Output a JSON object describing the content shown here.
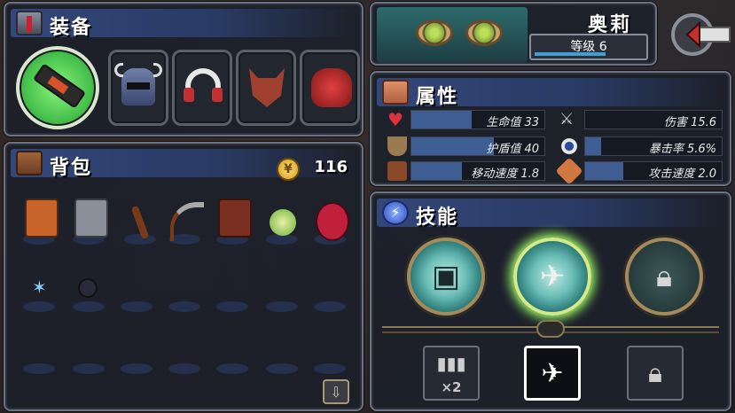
{
  "equipment": {
    "title": "装备",
    "slots": [
      {
        "icon": "weapon-blaster-icon"
      },
      {
        "icon": "horned-helmet-icon"
      },
      {
        "icon": "headphones-icon"
      },
      {
        "icon": "werewolf-mask-icon"
      },
      {
        "icon": "red-demon-icon"
      }
    ]
  },
  "backpack": {
    "title": "背包",
    "coins": "116",
    "items_row1": [
      "orange-robot-icon",
      "gray-robot-icon",
      "stick-icon",
      "scythe-icon",
      "tiki-mask-icon",
      "green-orb-icon",
      "monster-mouth-icon"
    ],
    "items_row2": [
      "blue-spark-icon",
      "bomb-icon"
    ]
  },
  "character": {
    "name": "奥莉",
    "level_text": "等级 6",
    "level_progress": 0.6
  },
  "attributes": {
    "title": "属性",
    "items": [
      {
        "label": "生命值 33",
        "icon": "heart-icon",
        "fill": 0.45
      },
      {
        "label": "伤害 15.6",
        "icon": "sword-icon",
        "fill": 0.0
      },
      {
        "label": "护盾值 40",
        "icon": "shield-icon",
        "fill": 0.62
      },
      {
        "label": "暴击率 5.6%",
        "icon": "eye-icon",
        "fill": 0.12
      },
      {
        "label": "移动速度 1.8",
        "icon": "boot-icon",
        "fill": 0.38
      },
      {
        "label": "攻击速度 2.0",
        "icon": "fist-icon",
        "fill": 0.28
      }
    ]
  },
  "skills": {
    "title": "技能",
    "orbs": [
      {
        "icon": "turret-skill-icon",
        "state": "unlocked"
      },
      {
        "icon": "helicopter-skill-icon",
        "state": "selected"
      },
      {
        "icon": "lock-icon",
        "state": "locked"
      }
    ],
    "talents": [
      {
        "icon": "bullets-icon",
        "text": "×2"
      },
      {
        "icon": "helicopter-blueprint-icon",
        "text": ""
      },
      {
        "icon": "lock-icon",
        "text": ""
      }
    ]
  }
}
